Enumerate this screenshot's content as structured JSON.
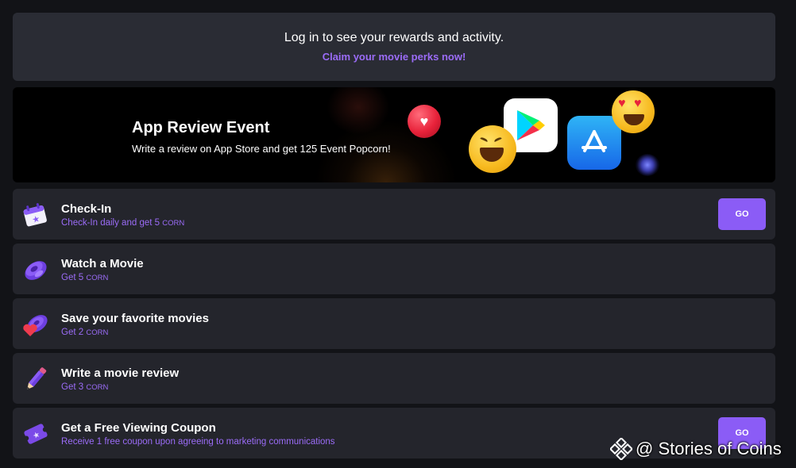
{
  "login": {
    "message": "Log in to see your rewards and activity.",
    "link": "Claim your movie perks now!"
  },
  "banner": {
    "title": "App Review Event",
    "description": "Write a review on App Store and get 125 Event Popcorn!",
    "icons": [
      "heart-ball-icon",
      "laughing-emoji-icon",
      "google-play-icon",
      "app-store-icon",
      "heart-eyes-emoji-icon",
      "blue-orb-icon"
    ]
  },
  "tasks": [
    {
      "title": "Check-In",
      "subtitle": "Check-In daily and get 5",
      "unit": "CORN",
      "button": "GO",
      "icon": "calendar-icon"
    },
    {
      "title": "Watch a Movie",
      "subtitle": "Get 5",
      "unit": "CORN",
      "button": "",
      "icon": "film-reel-icon"
    },
    {
      "title": "Save your favorite movies",
      "subtitle": "Get 2",
      "unit": "CORN",
      "button": "",
      "icon": "film-heart-icon"
    },
    {
      "title": "Write a movie review",
      "subtitle": "Get 3",
      "unit": "CORN",
      "button": "",
      "icon": "pencil-icon"
    },
    {
      "title": "Get a Free Viewing Coupon",
      "subtitle": "Receive 1 free coupon upon agreeing to marketing communications",
      "unit": "",
      "button": "GO",
      "icon": "ticket-icon"
    }
  ],
  "watermark": {
    "text": "@ Stories of Coins"
  },
  "colors": {
    "accent": "#8b5cf6",
    "link": "#9b6cf7",
    "card": "#24252c",
    "background": "#121317"
  }
}
